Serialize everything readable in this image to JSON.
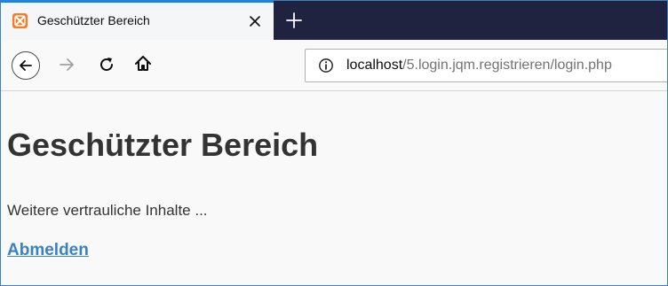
{
  "browser": {
    "tab": {
      "title": "Geschützter Bereich",
      "favicon": "xampp-icon"
    },
    "url": {
      "host": "localhost",
      "path": "/5.login.jqm.registrieren/login.php"
    },
    "icons": {
      "back": "back-arrow-icon",
      "forward": "forward-arrow-icon",
      "reload": "reload-icon",
      "home": "home-icon",
      "info": "info-icon",
      "close": "close-icon",
      "new_tab": "plus-icon"
    },
    "colors": {
      "tabstrip": "#202340",
      "accent": "#0a84ff",
      "favicon": "#fb7a24",
      "link": "#3a81c4",
      "text": "#333333"
    }
  },
  "page": {
    "title": "Geschützter Bereich",
    "text": "Weitere vertrauliche Inhalte ...",
    "logout_link": "Abmelden"
  }
}
